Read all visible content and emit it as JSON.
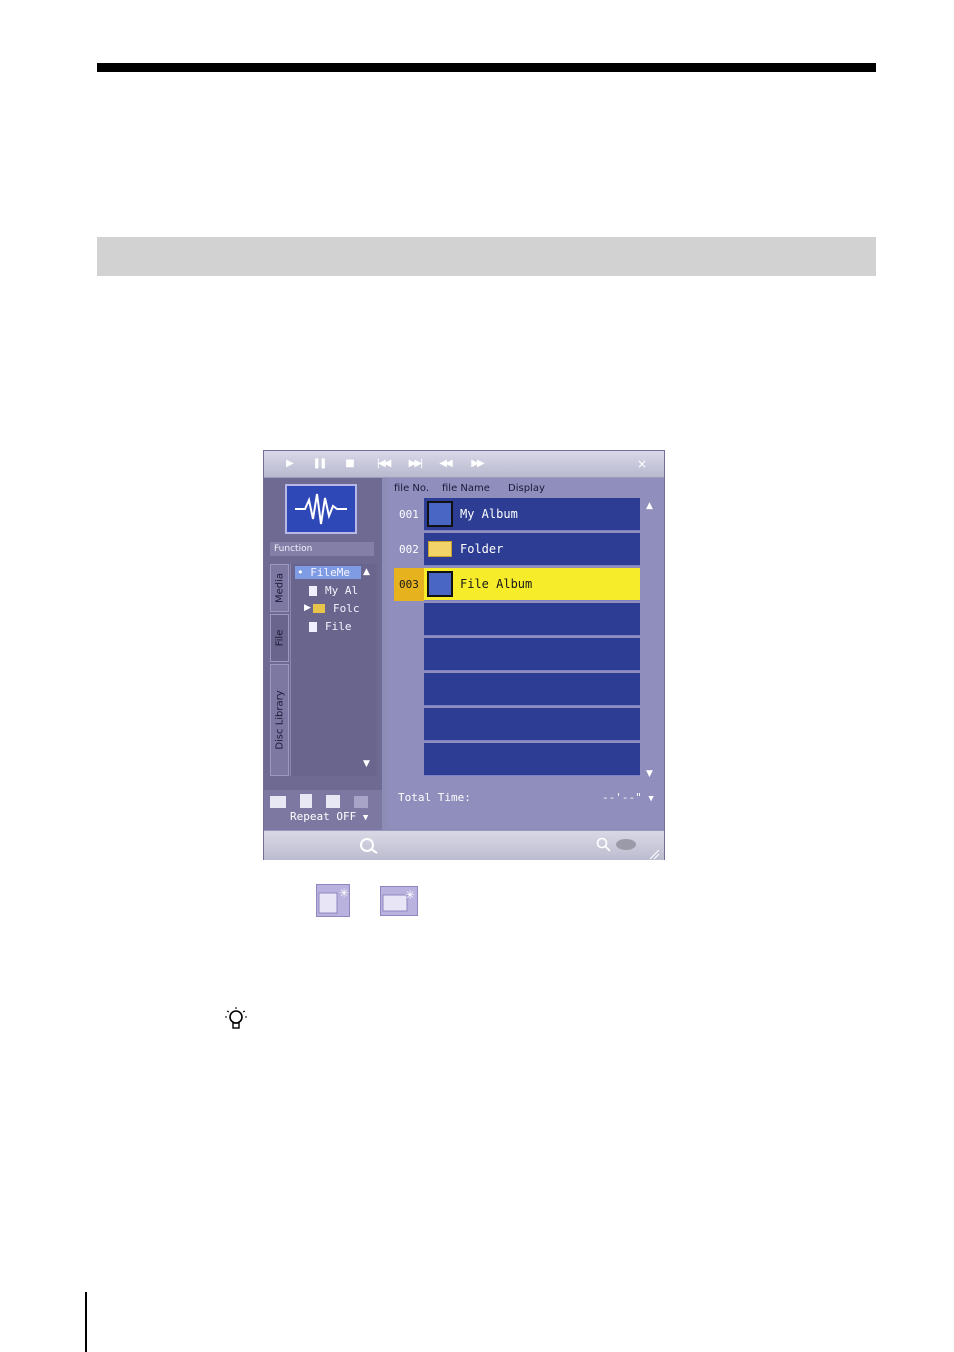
{
  "player": {
    "close_label": "×",
    "function_label": "Function",
    "tabs": [
      "Media",
      "File",
      "Disc Library"
    ],
    "tree": [
      {
        "label": "FileMe",
        "icon": "dot-icon"
      },
      {
        "label": "My Al",
        "icon": "file-icon"
      },
      {
        "label": "Folc",
        "icon": "folder-icon"
      },
      {
        "label": "File",
        "icon": "file-icon"
      }
    ],
    "repeat_label": "Repeat  OFF",
    "columns": {
      "no": "file No.",
      "name": "file Name",
      "display": "Display"
    },
    "rows": [
      {
        "no": "001",
        "name": "My Album",
        "icon": "album-icon",
        "selected": false
      },
      {
        "no": "002",
        "name": "Folder",
        "icon": "folder-icon",
        "selected": false
      },
      {
        "no": "003",
        "name": "File Album",
        "icon": "album-icon",
        "selected": true
      },
      {
        "no": "",
        "name": "",
        "icon": "",
        "selected": false
      },
      {
        "no": "",
        "name": "",
        "icon": "",
        "selected": false
      },
      {
        "no": "",
        "name": "",
        "icon": "",
        "selected": false
      },
      {
        "no": "",
        "name": "",
        "icon": "",
        "selected": false
      },
      {
        "no": "",
        "name": "",
        "icon": "",
        "selected": false
      }
    ],
    "total_time_label": "Total  Time:",
    "total_time_value": "--'--\""
  }
}
